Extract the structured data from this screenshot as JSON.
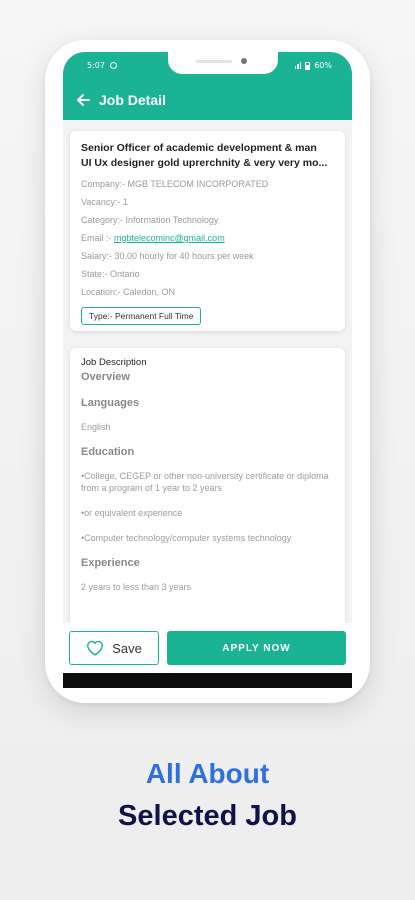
{
  "status": {
    "time": "5:07",
    "battery": "60%"
  },
  "header": {
    "title": "Job Detail"
  },
  "job": {
    "title_line1": "Senior Officer of academic development & man",
    "title_line2": "UI Ux designer gold uprerchnity & very very mo...",
    "company": "Company:- MGB TELECOM INCORPORATED",
    "vacancy": "Vacancy:- 1",
    "category": "Category:- Information Technology",
    "email_label": "Email :- ",
    "email": "mgbtelecominc@gmail.com",
    "salary": "Salary:- 30.00 hourly for 40 hours per week",
    "state": "State:- Ontario",
    "location": "Location:- Caledon, ON",
    "type": "Type:- Permanent Full Time"
  },
  "description": {
    "heading": "Job Description",
    "overview": "Overview",
    "languages": "Languages",
    "language_value": "English",
    "education": "Education",
    "edu_item1": "•College, CEGEP or other non-university certificate or diploma from a program of 1 year to 2 years",
    "edu_item2": "•or equivalent experience",
    "edu_item3": "•Computer technology/computer systems technology",
    "experience": "Experience",
    "experience_value": "2 years to less than 3 years"
  },
  "actions": {
    "save_label": "Save",
    "apply_label": "APPLY NOW"
  },
  "caption": {
    "line1": "All About",
    "line2": "Selected Job"
  },
  "colors": {
    "accent": "#1ab394",
    "caption_blue": "#2f6fde",
    "caption_dark": "#12124a"
  }
}
